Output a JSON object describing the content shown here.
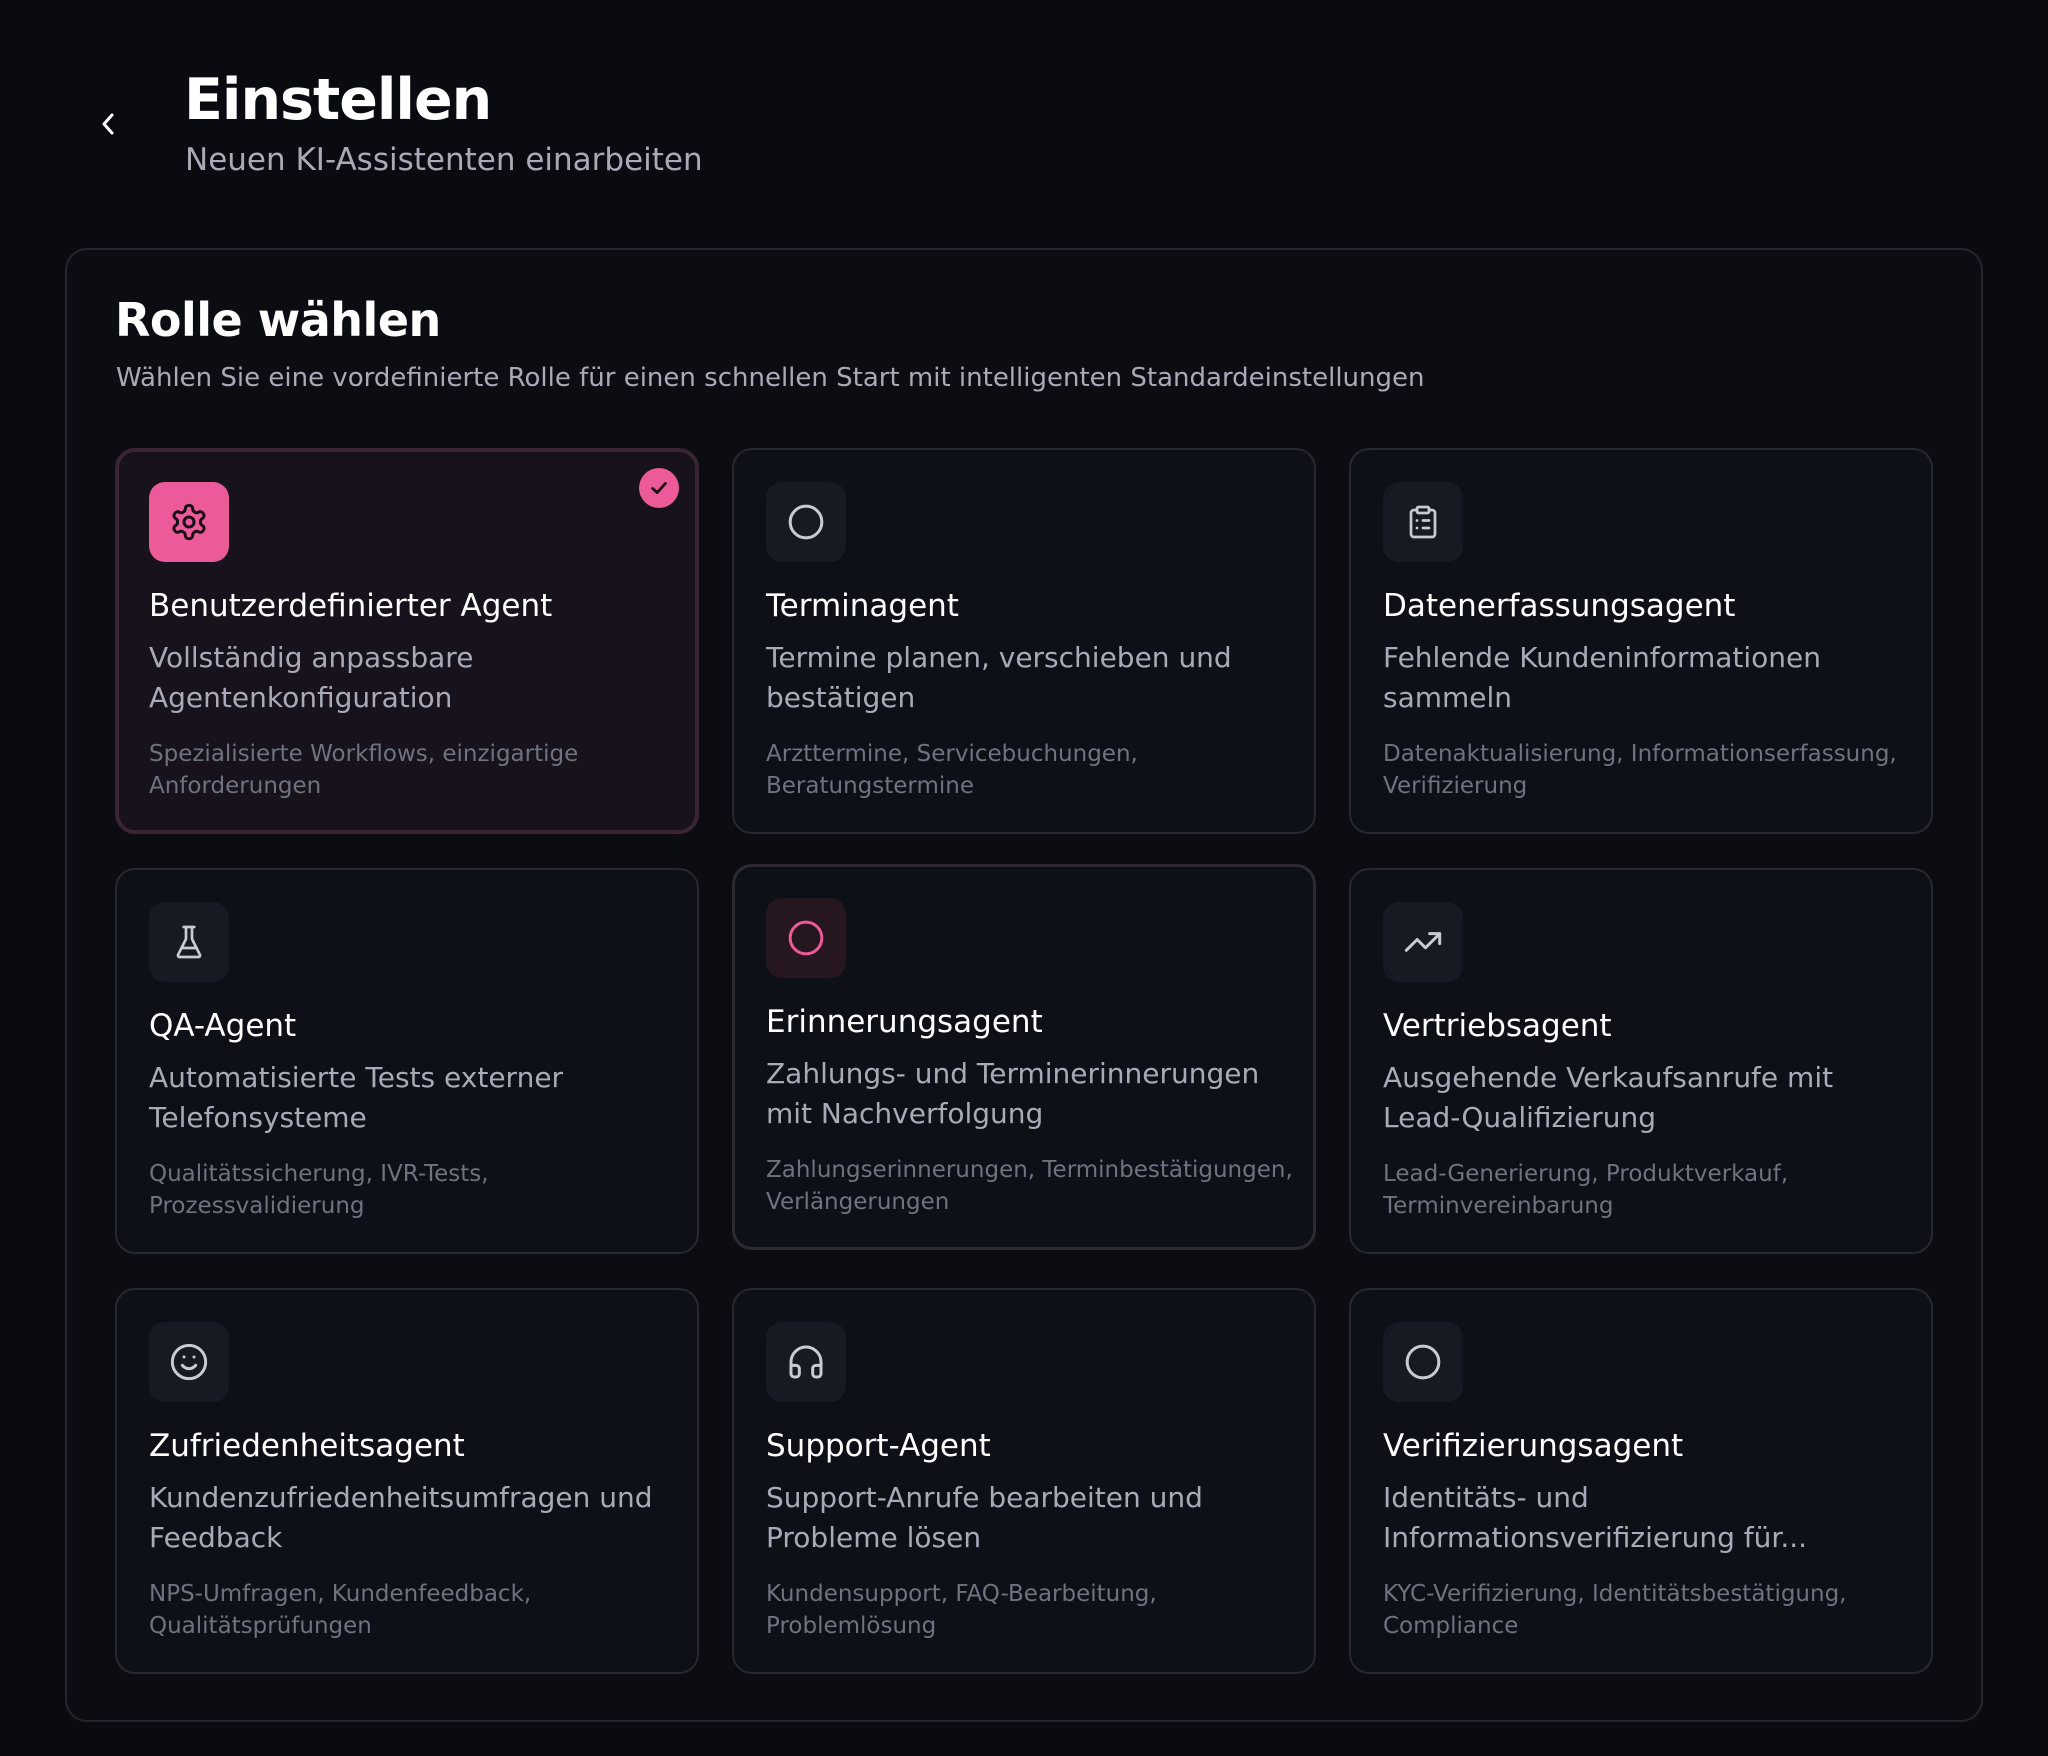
{
  "header": {
    "title": "Einstellen",
    "subtitle": "Neuen KI-Assistenten einarbeiten"
  },
  "section": {
    "title": "Rolle wählen",
    "description": "Wählen Sie eine vordefinierte Rolle für einen schnellen Start mit intelligenten Standardeinstellungen"
  },
  "colors": {
    "accent": "#ed5a9a",
    "background": "#0a0b10",
    "panel": "#0c0d13",
    "card": "#0e1017"
  },
  "roles": [
    {
      "title": "Benutzerdefinierter Agent",
      "description": "Vollständig anpassbare Agentenkonfiguration",
      "tags": "Spezialisierte Workflows, einzigartige Anforderungen",
      "icon": "gear-icon",
      "selected": true
    },
    {
      "title": "Terminagent",
      "description": "Termine planen, verschieben und bestätigen",
      "tags": "Arzttermine, Servicebuchungen, Beratungstermine",
      "icon": "circle-icon",
      "selected": false
    },
    {
      "title": "Datenerfassungsagent",
      "description": "Fehlende Kundeninformationen sammeln",
      "tags": "Datenaktualisierung, Informationserfassung, Verifizierung",
      "icon": "clipboard-icon",
      "selected": false
    },
    {
      "title": "QA-Agent",
      "description": "Automatisierte Tests externer Telefonsysteme",
      "tags": "Qualitätssicherung, IVR-Tests, Prozessvalidierung",
      "icon": "flask-icon",
      "selected": false
    },
    {
      "title": "Erinnerungsagent",
      "description": "Zahlungs- und Terminerinnerungen mit Nachverfolgung",
      "tags": "Zahlungserinnerungen, Terminbestätigungen, Verlängerungen",
      "icon": "circle-icon",
      "selected": false
    },
    {
      "title": "Vertriebsagent",
      "description": "Ausgehende Verkaufsanrufe mit Lead-Qualifizierung",
      "tags": "Lead-Generierung, Produktverkauf, Terminvereinbarung",
      "icon": "trending-up-icon",
      "selected": false
    },
    {
      "title": "Zufriedenheitsagent",
      "description": "Kundenzufriedenheitsumfragen und Feedback",
      "tags": "NPS-Umfragen, Kundenfeedback, Qualitätsprüfungen",
      "icon": "smile-icon",
      "selected": false
    },
    {
      "title": "Support-Agent",
      "description": "Support-Anrufe bearbeiten und Probleme lösen",
      "tags": "Kundensupport, FAQ-Bearbeitung, Problemlösung",
      "icon": "headphones-icon",
      "selected": false
    },
    {
      "title": "Verifizierungsagent",
      "description": "Identitäts- und Informationsverifizierung für...",
      "tags": "KYC-Verifizierung, Identitätsbestätigung, Compliance",
      "icon": "circle-icon",
      "selected": false
    }
  ]
}
